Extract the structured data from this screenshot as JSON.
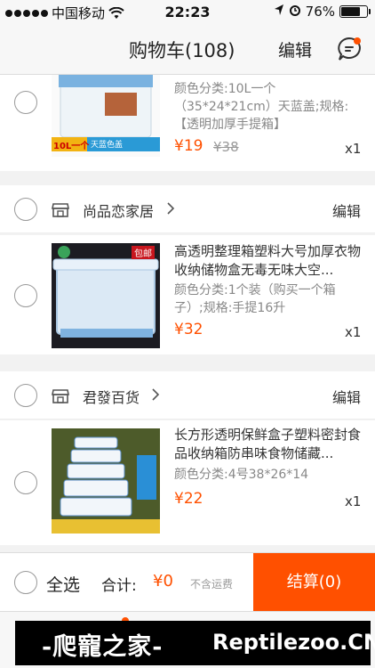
{
  "status_bar": {
    "carrier": "中国移动",
    "time": "22:23",
    "battery": "76%",
    "battery_level": 0.76
  },
  "nav": {
    "title": "购物车(108)",
    "edit_label": "编辑",
    "message_icon": "message-bubble-icon"
  },
  "items": [
    {
      "spec": "颜色分类:10L一个（35*24*21cm）天蓝盖;规格:【透明加厚手提箱】",
      "price": "¥19",
      "old_price": "¥38",
      "qty": "x1",
      "thumb_banner": "10L一个",
      "thumb_banner2": "天蓝色盖"
    },
    {
      "title": "高透明整理箱塑料大号加厚衣物收纳储物盒无毒无味大空...",
      "spec": "颜色分类:1个装（购买一个箱子）;规格:手提16升",
      "price": "¥32",
      "qty": "x1",
      "thumb_badge": "包邮"
    },
    {
      "title": "长方形透明保鲜盒子塑料密封食品收纳箱防串味食物储藏...",
      "spec": "颜色分类:4号38*26*14",
      "price": "¥22",
      "qty": "x1"
    }
  ],
  "shops": [
    {
      "name": "尚品恋家居",
      "edit_label": "编辑"
    },
    {
      "name": "君發百货",
      "edit_label": "编辑"
    }
  ],
  "bottom": {
    "select_all": "全选",
    "total_label": "合计:",
    "total_value": "¥0",
    "shipping_note": "不含运费",
    "checkout": "结算(0)"
  },
  "watermark": {
    "cn": "-爬寵之家-",
    "en": "Reptilezoo.CN"
  },
  "colors": {
    "accent": "#ff5000"
  }
}
